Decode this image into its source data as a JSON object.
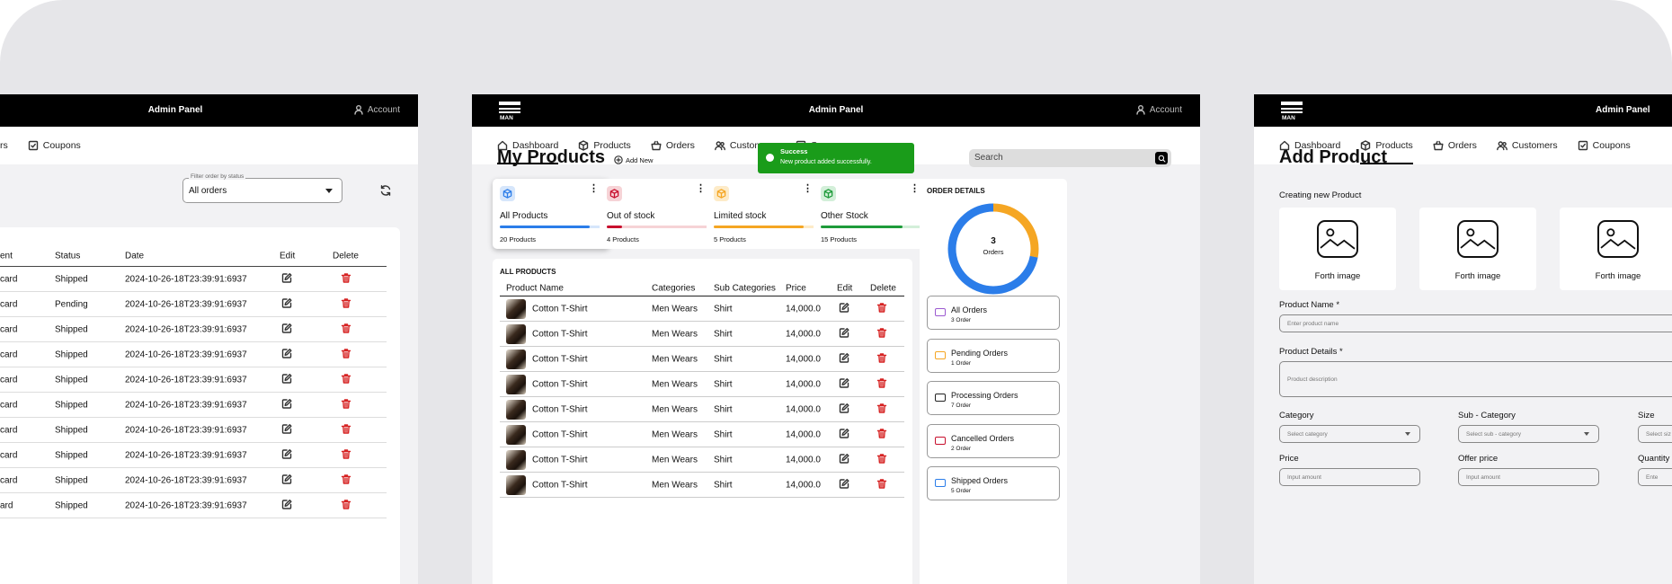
{
  "shared": {
    "admin_title": "Admin Panel",
    "account": "Account",
    "nav": [
      "Dashboard",
      "Products",
      "Orders",
      "Customers",
      "Coupons"
    ]
  },
  "orders_page": {
    "nav_visible": [
      "rs",
      "Coupons"
    ],
    "filter_label": "Filter order by status",
    "filter_value": "All orders",
    "columns": [
      "ent",
      "Status",
      "Date",
      "Edit",
      "Delete"
    ],
    "rows": [
      {
        "payment": "card",
        "status": "Shipped",
        "date": "2024-10-26-18T23:39:91:6937"
      },
      {
        "payment": "card",
        "status": "Pending",
        "date": "2024-10-26-18T23:39:91:6937"
      },
      {
        "payment": "card",
        "status": "Shipped",
        "date": "2024-10-26-18T23:39:91:6937"
      },
      {
        "payment": "card",
        "status": "Shipped",
        "date": "2024-10-26-18T23:39:91:6937"
      },
      {
        "payment": "card",
        "status": "Shipped",
        "date": "2024-10-26-18T23:39:91:6937"
      },
      {
        "payment": "card",
        "status": "Shipped",
        "date": "2024-10-26-18T23:39:91:6937"
      },
      {
        "payment": "card",
        "status": "Shipped",
        "date": "2024-10-26-18T23:39:91:6937"
      },
      {
        "payment": "card",
        "status": "Shipped",
        "date": "2024-10-26-18T23:39:91:6937"
      },
      {
        "payment": "card",
        "status": "Shipped",
        "date": "2024-10-26-18T23:39:91:6937"
      },
      {
        "payment": "ard",
        "status": "Shipped",
        "date": "2024-10-26-18T23:39:91:6937"
      }
    ]
  },
  "products_page": {
    "title": "My Products",
    "add_new": "Add New",
    "toast": {
      "title": "Success",
      "message": "New product added successfully."
    },
    "search_placeholder": "Search",
    "stats": [
      {
        "name": "All Products",
        "count": "20 Products",
        "color": "#2b7de9",
        "tint": "#d6e6fb",
        "level": 0.88
      },
      {
        "name": "Out of stock",
        "count": "4 Products",
        "color": "#c8102e",
        "tint": "#f6d3d6",
        "level": 0.15
      },
      {
        "name": "Limited stock",
        "count": "5 Products",
        "color": "#f5a623",
        "tint": "#fdebc8",
        "level": 0.88
      },
      {
        "name": "Other Stock",
        "count": "15 Products",
        "color": "#1e9b3a",
        "tint": "#d3efd9",
        "level": 0.8
      }
    ],
    "table_title": "ALL PRODUCTS",
    "columns": [
      "Product Name",
      "Categories",
      "Sub Categories",
      "Price",
      "Edit",
      "Delete"
    ],
    "rows": [
      {
        "name": "Cotton T-Shirt",
        "category": "Men Wears",
        "sub": "Shirt",
        "price": "14,000.0"
      },
      {
        "name": "Cotton T-Shirt",
        "category": "Men Wears",
        "sub": "Shirt",
        "price": "14,000.0"
      },
      {
        "name": "Cotton T-Shirt",
        "category": "Men Wears",
        "sub": "Shirt",
        "price": "14,000.0"
      },
      {
        "name": "Cotton T-Shirt",
        "category": "Men Wears",
        "sub": "Shirt",
        "price": "14,000.0"
      },
      {
        "name": "Cotton T-Shirt",
        "category": "Men Wears",
        "sub": "Shirt",
        "price": "14,000.0"
      },
      {
        "name": "Cotton T-Shirt",
        "category": "Men Wears",
        "sub": "Shirt",
        "price": "14,000.0"
      },
      {
        "name": "Cotton T-Shirt",
        "category": "Men Wears",
        "sub": "Shirt",
        "price": "14,000.0"
      },
      {
        "name": "Cotton T-Shirt",
        "category": "Men Wears",
        "sub": "Shirt",
        "price": "14,000.0"
      }
    ],
    "order_details": {
      "title": "ORDER DETAILS",
      "center_count": "3",
      "center_label": "Orders",
      "ring_colors": [
        "#2b7de9",
        "#f5a623"
      ],
      "ring_share": [
        0.72,
        0.28
      ],
      "items": [
        {
          "name": "All Orders",
          "count": "3 Order",
          "color": "#9b59d0"
        },
        {
          "name": "Pending Orders",
          "count": "1 Order",
          "color": "#f5a623"
        },
        {
          "name": "Processing Orders",
          "count": "7 Order",
          "color": "#222222"
        },
        {
          "name": "Cancelled Orders",
          "count": "2 Order",
          "color": "#c8102e"
        },
        {
          "name": "Shipped Orders",
          "count": "5 Order",
          "color": "#2b7de9"
        }
      ]
    }
  },
  "add_product_page": {
    "nav_visible": [
      "Dashboard",
      "Products",
      "Orders",
      "Customers",
      "Coupons"
    ],
    "title": "Add Product",
    "subtitle": "Creating new Product",
    "image_captions": [
      "Forth image",
      "Forth image",
      "Forth image"
    ],
    "product_name_label": "Product Name *",
    "product_name_placeholder": "Enter product name",
    "product_details_label": "Product Details *",
    "product_details_placeholder": "Product description",
    "category_label": "Category",
    "category_placeholder": "Select category",
    "subcategory_label": "Sub - Category",
    "subcategory_placeholder": "Select sub - category",
    "size_label": "Size",
    "size_placeholder": "Select siz",
    "price_label": "Price",
    "price_placeholder": "Input amount",
    "offer_label": "Offer price",
    "offer_placeholder": "Input amount",
    "quantity_label": "Quantity",
    "quantity_placeholder": "Ente"
  }
}
